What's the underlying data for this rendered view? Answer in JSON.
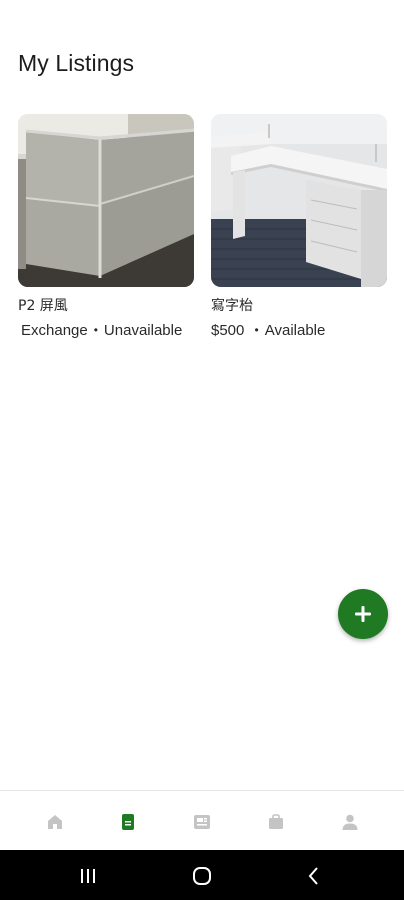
{
  "header": {
    "title": "My Listings"
  },
  "listings": [
    {
      "title": "P2 屏風",
      "price": "Exchange",
      "status": "Unavailable"
    },
    {
      "title": "寫字枱",
      "price": "$500 ",
      "status": "Available"
    }
  ],
  "fab": {
    "icon": "plus-icon"
  },
  "bottom_nav": {
    "items": [
      {
        "icon": "home-icon",
        "active": false
      },
      {
        "icon": "listings-icon",
        "active": true
      },
      {
        "icon": "feed-icon",
        "active": false
      },
      {
        "icon": "bag-icon",
        "active": false
      },
      {
        "icon": "profile-icon",
        "active": false
      }
    ]
  },
  "colors": {
    "accent": "#1f7a23",
    "nav_inactive": "#c4c4c4"
  }
}
